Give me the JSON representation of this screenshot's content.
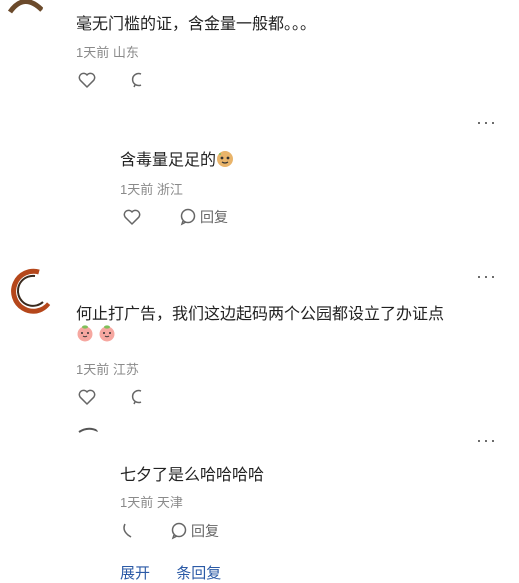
{
  "comments": [
    {
      "text": "毫无门槛的证，含金量一般都。。。",
      "time": "1天前",
      "location": "山东"
    },
    {
      "text": "含毒量足足的",
      "emoji": "cookie-face-emoji",
      "time": "1天前",
      "location": "浙江",
      "reply_label": "回复"
    },
    {
      "text": "何止打广告，我们这边起码两个公园都设立了办证点",
      "emojis": [
        "peach-face-emoji",
        "peach-face-emoji"
      ],
      "time": "1天前",
      "location": "江苏"
    },
    {
      "text": "七夕了是么哈哈哈哈",
      "time": "1天前",
      "location": "天津",
      "reply_label": "回复"
    }
  ],
  "more_label": "···",
  "expand": {
    "left": "展开",
    "right": "条回复"
  },
  "colors": {
    "link": "#2b5aa6",
    "meta": "#8a8a8a"
  }
}
